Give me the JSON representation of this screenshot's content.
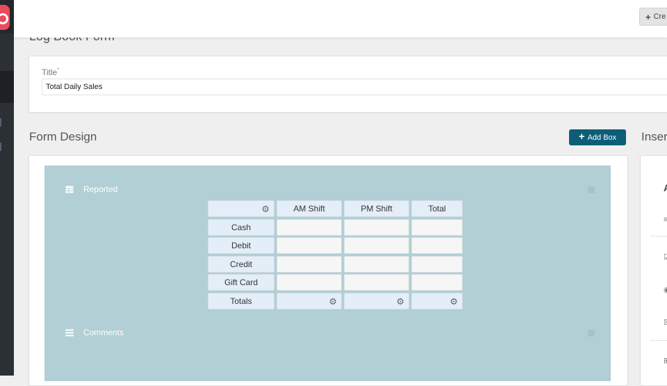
{
  "header": {
    "create_label": "Cre"
  },
  "page": {
    "heading": "Log Book Form"
  },
  "title_field": {
    "label": "Title",
    "required_mark": "*",
    "value": "Total Daily Sales"
  },
  "form_design": {
    "title": "Form Design",
    "add_box_label": "Add Box",
    "boxes": [
      {
        "label": "Reported",
        "icon": "table-icon"
      },
      {
        "label": "Comments",
        "icon": "list-icon"
      }
    ]
  },
  "table": {
    "columns": [
      "",
      "AM Shift",
      "PM Shift",
      "Total"
    ],
    "rows": [
      {
        "label": "Cash"
      },
      {
        "label": "Debit"
      },
      {
        "label": "Credit"
      },
      {
        "label": "Gift Card"
      },
      {
        "label": "Totals"
      }
    ]
  },
  "insert_panel": {
    "title": "Inser"
  },
  "colors": {
    "sidebar": "#2b3037",
    "brand": "#e94b5b",
    "add_button": "#0c5d78",
    "canvas": "#b1cfd5",
    "header_cell": "#e4eef8"
  }
}
